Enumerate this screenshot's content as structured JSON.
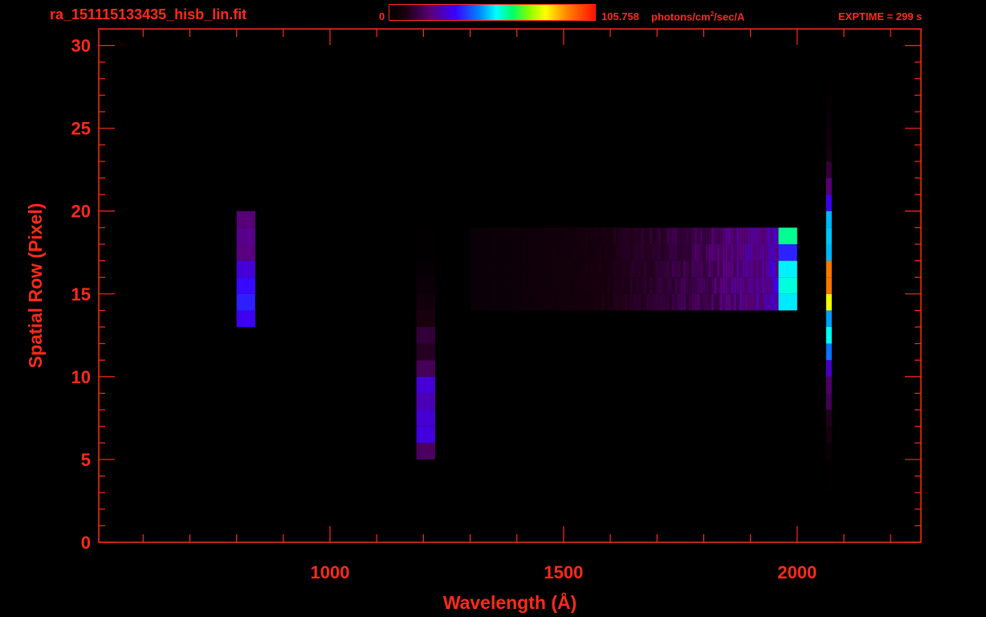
{
  "header": {
    "filename": "ra_151115133435_hisb_lin.fit",
    "colorbar_min": "0",
    "colorbar_max": "105.758",
    "colorbar_unit_pre": "photons/cm",
    "colorbar_unit_sup": "2",
    "colorbar_unit_post": "/sec/A",
    "exptime": "EXPTIME = 299 s"
  },
  "colors": {
    "axis": "#ff2a1a",
    "background": "#000000"
  },
  "chart_data": {
    "type": "heatmap",
    "title": "",
    "xlabel": "Wavelength (Å)",
    "ylabel": "Spatial Row (Pixel)",
    "xlim": [
      505,
      2265
    ],
    "ylim": [
      0,
      31
    ],
    "x_major_ticks": [
      1000,
      1500,
      2000
    ],
    "x_minor_step": 100,
    "y_major_ticks": [
      0,
      5,
      10,
      15,
      20,
      25,
      30
    ],
    "y_minor_step": 1,
    "colorbar_range": [
      0,
      105.758
    ],
    "emission_features": [
      {
        "wavelength": 820,
        "rows": [
          13.5,
          19.5
        ],
        "peak_row": 15.5,
        "intensity": 40
      },
      {
        "wavelength": 1205,
        "rows": [
          5,
          24
        ],
        "peak_row": 7.5,
        "intensity": 35
      },
      {
        "wavelength": 1980,
        "rows": [
          14,
          19
        ],
        "peak_row": 16.5,
        "intensity": 75
      },
      {
        "wavelength": 2068,
        "rows": [
          2,
          29
        ],
        "peak_row": 15.5,
        "intensity": 105
      }
    ]
  }
}
